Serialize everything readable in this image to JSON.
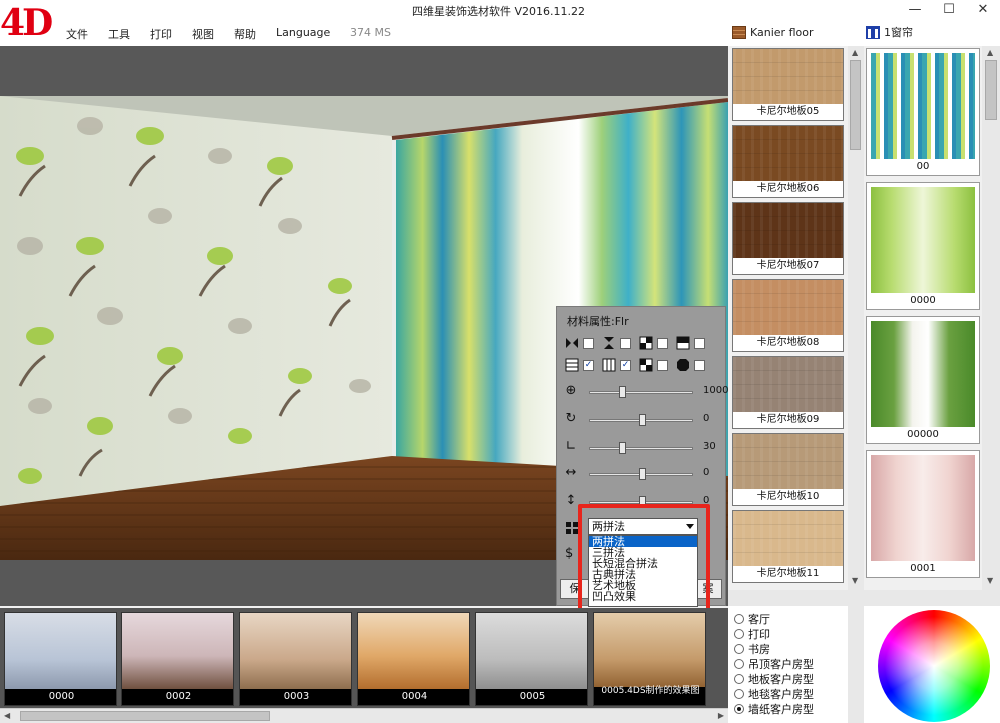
{
  "app": {
    "logo": "4D",
    "title": "四维星装饰选材软件  V2016.11.22",
    "latency": "374 MS"
  },
  "menu": [
    {
      "label": "文件"
    },
    {
      "label": "工具"
    },
    {
      "label": "打印"
    },
    {
      "label": "视图"
    },
    {
      "label": "帮助"
    },
    {
      "label": "Language"
    }
  ],
  "product_tabs": [
    {
      "label": "Kanier floor",
      "icon": "floor-icon"
    },
    {
      "label": "1窗帘",
      "icon": "curtain-icon"
    }
  ],
  "window_controls": {
    "minimize": "—",
    "maximize": "☐",
    "close": "✕"
  },
  "material_panel": {
    "title": "材料属性:Flr",
    "checkbox_row1": [
      false,
      false,
      false,
      false
    ],
    "checkbox_row2": [
      true,
      true,
      false,
      false
    ],
    "sliders": [
      {
        "icon": "zoom-icon",
        "glyph": "⊕",
        "value": "1000",
        "level": 0.3
      },
      {
        "icon": "rotate-icon",
        "glyph": "↻",
        "value": "0",
        "level": 0.5
      },
      {
        "icon": "angle-icon",
        "glyph": "∟",
        "value": "30",
        "level": 0.3
      },
      {
        "icon": "horizontal-shift-icon",
        "glyph": "↔",
        "value": "0",
        "level": 0.5
      },
      {
        "icon": "vertical-shift-icon",
        "glyph": "↕",
        "value": "0",
        "level": 0.5
      }
    ],
    "pattern_select": {
      "selected": "两拼法",
      "options": [
        "两拼法",
        "三拼法",
        "长短混合拼法",
        "古典拼法",
        "艺术地板",
        "凹凸效果"
      ]
    },
    "button_left": "保",
    "button_right": "案"
  },
  "rooms": [
    {
      "label": "0000"
    },
    {
      "label": "0002"
    },
    {
      "label": "0003"
    },
    {
      "label": "0004"
    },
    {
      "label": "0005"
    },
    {
      "label": "0005.4DS制作的效果图"
    }
  ],
  "floors": [
    {
      "label": "卡尼尔地板05",
      "color": "#c29a6c"
    },
    {
      "label": "卡尼尔地板06",
      "color": "#7a4a22"
    },
    {
      "label": "卡尼尔地板07",
      "color": "#5e3418"
    },
    {
      "label": "卡尼尔地板08",
      "color": "#c48e62"
    },
    {
      "label": "卡尼尔地板09",
      "color": "#968374"
    },
    {
      "label": "卡尼尔地板10",
      "color": "#b79a78"
    },
    {
      "label": "卡尼尔地板11",
      "color": "#d9b88c"
    }
  ],
  "curtains": [
    {
      "label": "00"
    },
    {
      "label": "0000"
    },
    {
      "label": "00000"
    },
    {
      "label": "0001"
    }
  ],
  "room_types": [
    {
      "label": "客厅",
      "selected": false
    },
    {
      "label": "打印",
      "selected": false
    },
    {
      "label": "书房",
      "selected": false
    },
    {
      "label": "吊顶客户房型",
      "selected": false
    },
    {
      "label": "地板客户房型",
      "selected": false
    },
    {
      "label": "地毯客户房型",
      "selected": false
    },
    {
      "label": "墙纸客户房型",
      "selected": true
    }
  ]
}
